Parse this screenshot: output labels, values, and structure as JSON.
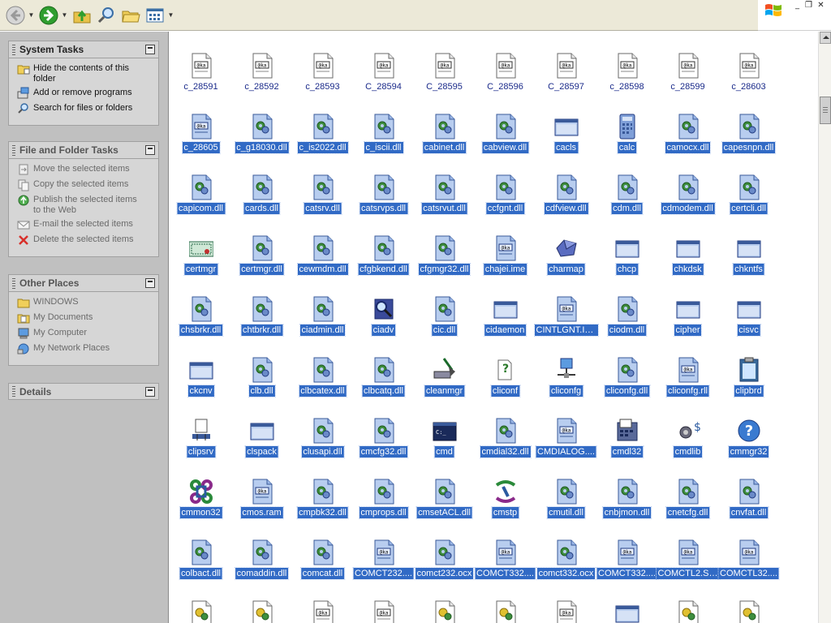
{
  "toolbar": {
    "buttons": [
      "back-icon",
      "forward-icon",
      "up-folder-icon",
      "search-icon",
      "folders-icon",
      "views-icon"
    ]
  },
  "panels": {
    "system": {
      "title": "System Tasks",
      "items": [
        {
          "icon": "hide-contents-icon",
          "label_line1": "Hide the contents of this",
          "label_line2": "folder"
        },
        {
          "icon": "add-remove-icon",
          "label_line1": "Add or remove programs",
          "label_line2": ""
        },
        {
          "icon": "search-icon",
          "label_line1": "Search for files or folders",
          "label_line2": ""
        }
      ]
    },
    "file": {
      "title": "File and Folder Tasks",
      "items": [
        {
          "icon": "move-icon",
          "label_line1": "Move the selected items",
          "label_line2": ""
        },
        {
          "icon": "copy-icon",
          "label_line1": "Copy the selected items",
          "label_line2": ""
        },
        {
          "icon": "publish-icon",
          "label_line1": "Publish the selected items",
          "label_line2": "to the Web"
        },
        {
          "icon": "email-icon",
          "label_line1": "E-mail the selected items",
          "label_line2": ""
        },
        {
          "icon": "delete-icon",
          "label_line1": "Delete the selected items",
          "label_line2": ""
        }
      ]
    },
    "places": {
      "title": "Other Places",
      "items": [
        {
          "icon": "folder-icon",
          "label": "WINDOWS"
        },
        {
          "icon": "my-documents-icon",
          "label": "My Documents"
        },
        {
          "icon": "my-computer-icon",
          "label": "My Computer"
        },
        {
          "icon": "network-places-icon",
          "label": "My Network Places"
        }
      ]
    },
    "details": {
      "title": "Details"
    }
  },
  "files": [
    {
      "name": "c_28591",
      "type": "nls",
      "selected": false
    },
    {
      "name": "c_28592",
      "type": "nls",
      "selected": false
    },
    {
      "name": "c_28593",
      "type": "nls",
      "selected": false
    },
    {
      "name": "C_28594",
      "type": "nls",
      "selected": false
    },
    {
      "name": "C_28595",
      "type": "nls",
      "selected": false
    },
    {
      "name": "C_28596",
      "type": "nls",
      "selected": false
    },
    {
      "name": "C_28597",
      "type": "nls",
      "selected": false
    },
    {
      "name": "c_28598",
      "type": "nls",
      "selected": false
    },
    {
      "name": "c_28599",
      "type": "nls",
      "selected": false
    },
    {
      "name": "c_28603",
      "type": "nls",
      "selected": false
    },
    {
      "name": "c_28605",
      "type": "nls-blue",
      "selected": true
    },
    {
      "name": "c_g18030.dll",
      "type": "dll",
      "selected": true
    },
    {
      "name": "c_is2022.dll",
      "type": "dll",
      "selected": true
    },
    {
      "name": "c_iscii.dll",
      "type": "dll",
      "selected": true
    },
    {
      "name": "cabinet.dll",
      "type": "dll",
      "selected": true
    },
    {
      "name": "cabview.dll",
      "type": "dll",
      "selected": true
    },
    {
      "name": "cacls",
      "type": "exe",
      "selected": true
    },
    {
      "name": "calc",
      "type": "calc",
      "selected": true
    },
    {
      "name": "camocx.dll",
      "type": "dll",
      "selected": true
    },
    {
      "name": "capesnpn.dll",
      "type": "dll",
      "selected": true
    },
    {
      "name": "capicom.dll",
      "type": "dll",
      "selected": true
    },
    {
      "name": "cards.dll",
      "type": "dll",
      "selected": true
    },
    {
      "name": "catsrv.dll",
      "type": "dll",
      "selected": true
    },
    {
      "name": "catsrvps.dll",
      "type": "dll",
      "selected": true
    },
    {
      "name": "catsrvut.dll",
      "type": "dll",
      "selected": true
    },
    {
      "name": "ccfgnt.dll",
      "type": "dll",
      "selected": true
    },
    {
      "name": "cdfview.dll",
      "type": "dll",
      "selected": true
    },
    {
      "name": "cdm.dll",
      "type": "dll",
      "selected": true
    },
    {
      "name": "cdmodem.dll",
      "type": "dll",
      "selected": true
    },
    {
      "name": "certcli.dll",
      "type": "dll",
      "selected": true
    },
    {
      "name": "certmgr",
      "type": "cert",
      "selected": true
    },
    {
      "name": "certmgr.dll",
      "type": "dll",
      "selected": true
    },
    {
      "name": "cewmdm.dll",
      "type": "dll",
      "selected": true
    },
    {
      "name": "cfgbkend.dll",
      "type": "dll",
      "selected": true
    },
    {
      "name": "cfgmgr32.dll",
      "type": "dll",
      "selected": true
    },
    {
      "name": "chajei.ime",
      "type": "nls-blue",
      "selected": true
    },
    {
      "name": "charmap",
      "type": "charmap",
      "selected": true
    },
    {
      "name": "chcp",
      "type": "exe",
      "selected": true
    },
    {
      "name": "chkdsk",
      "type": "exe",
      "selected": true
    },
    {
      "name": "chkntfs",
      "type": "exe",
      "selected": true
    },
    {
      "name": "chsbrkr.dll",
      "type": "dll",
      "selected": true
    },
    {
      "name": "chtbrkr.dll",
      "type": "dll",
      "selected": true
    },
    {
      "name": "ciadmin.dll",
      "type": "dll",
      "selected": true
    },
    {
      "name": "ciadv",
      "type": "ciadv",
      "selected": true
    },
    {
      "name": "cic.dll",
      "type": "dll",
      "selected": true
    },
    {
      "name": "cidaemon",
      "type": "exe",
      "selected": true
    },
    {
      "name": "CINTLGNT.IME",
      "type": "nls-blue",
      "selected": true
    },
    {
      "name": "ciodm.dll",
      "type": "dll",
      "selected": true
    },
    {
      "name": "cipher",
      "type": "exe",
      "selected": true
    },
    {
      "name": "cisvc",
      "type": "exe",
      "selected": true
    },
    {
      "name": "ckcnv",
      "type": "exe",
      "selected": true
    },
    {
      "name": "clb.dll",
      "type": "dll",
      "selected": true
    },
    {
      "name": "clbcatex.dll",
      "type": "dll",
      "selected": true
    },
    {
      "name": "clbcatq.dll",
      "type": "dll",
      "selected": true
    },
    {
      "name": "cleanmgr",
      "type": "cleanmgr",
      "selected": true
    },
    {
      "name": "cliconf",
      "type": "cliconf",
      "selected": true
    },
    {
      "name": "cliconfg",
      "type": "network",
      "selected": true
    },
    {
      "name": "cliconfg.dll",
      "type": "dll",
      "selected": true
    },
    {
      "name": "cliconfg.rll",
      "type": "nls-blue",
      "selected": true
    },
    {
      "name": "clipbrd",
      "type": "clipbrd",
      "selected": true
    },
    {
      "name": "clipsrv",
      "type": "clipsrv",
      "selected": true
    },
    {
      "name": "clspack",
      "type": "exe",
      "selected": true
    },
    {
      "name": "clusapi.dll",
      "type": "dll",
      "selected": true
    },
    {
      "name": "cmcfg32.dll",
      "type": "dll",
      "selected": true
    },
    {
      "name": "cmd",
      "type": "cmd",
      "selected": true
    },
    {
      "name": "cmdial32.dll",
      "type": "dll",
      "selected": true
    },
    {
      "name": "CMDIALOG....",
      "type": "nls-blue",
      "selected": true
    },
    {
      "name": "cmdl32",
      "type": "cmdl32",
      "selected": true
    },
    {
      "name": "cmdlib",
      "type": "cmdlib",
      "selected": true
    },
    {
      "name": "cmmgr32",
      "type": "help",
      "selected": true
    },
    {
      "name": "cmmon32",
      "type": "cmmon",
      "selected": true
    },
    {
      "name": "cmos.ram",
      "type": "nls-blue",
      "selected": true
    },
    {
      "name": "cmpbk32.dll",
      "type": "dll",
      "selected": true
    },
    {
      "name": "cmprops.dll",
      "type": "dll",
      "selected": true
    },
    {
      "name": "cmsetACL.dll",
      "type": "dll",
      "selected": true
    },
    {
      "name": "cmstp",
      "type": "cmstp",
      "selected": true
    },
    {
      "name": "cmutil.dll",
      "type": "dll",
      "selected": true
    },
    {
      "name": "cnbjmon.dll",
      "type": "dll",
      "selected": true
    },
    {
      "name": "cnetcfg.dll",
      "type": "dll",
      "selected": true
    },
    {
      "name": "cnvfat.dll",
      "type": "dll",
      "selected": true
    },
    {
      "name": "colbact.dll",
      "type": "dll",
      "selected": true
    },
    {
      "name": "comaddin.dll",
      "type": "dll",
      "selected": true
    },
    {
      "name": "comcat.dll",
      "type": "dll",
      "selected": true
    },
    {
      "name": "COMCT232....",
      "type": "nls-blue",
      "selected": true
    },
    {
      "name": "comct232.ocx",
      "type": "dll",
      "selected": true
    },
    {
      "name": "COMCT332....",
      "type": "nls-blue",
      "selected": true
    },
    {
      "name": "comct332.ocx",
      "type": "dll",
      "selected": true
    },
    {
      "name": "COMCT332....",
      "type": "nls-blue",
      "selected": true
    },
    {
      "name": "COMCTL2.SRG",
      "type": "nls-blue",
      "selected": true
    },
    {
      "name": "COMCTL32....",
      "type": "nls-blue",
      "selected": true
    },
    {
      "name": "",
      "type": "dll-yellow",
      "selected": false
    },
    {
      "name": "",
      "type": "dll-yellow",
      "selected": false
    },
    {
      "name": "",
      "type": "nls",
      "selected": false
    },
    {
      "name": "",
      "type": "nls",
      "selected": false
    },
    {
      "name": "",
      "type": "dll-yellow",
      "selected": false
    },
    {
      "name": "",
      "type": "dll-yellow",
      "selected": false
    },
    {
      "name": "",
      "type": "nls",
      "selected": false
    },
    {
      "name": "",
      "type": "exe",
      "selected": false
    },
    {
      "name": "",
      "type": "dll-yellow",
      "selected": false
    },
    {
      "name": "",
      "type": "dll-yellow",
      "selected": false
    }
  ],
  "colors": {
    "selection": "#316ac5",
    "pane_bg": "#c0c0c0",
    "panel_bg": "#d6d6d6",
    "toolbar_bg": "#ece9d8"
  }
}
